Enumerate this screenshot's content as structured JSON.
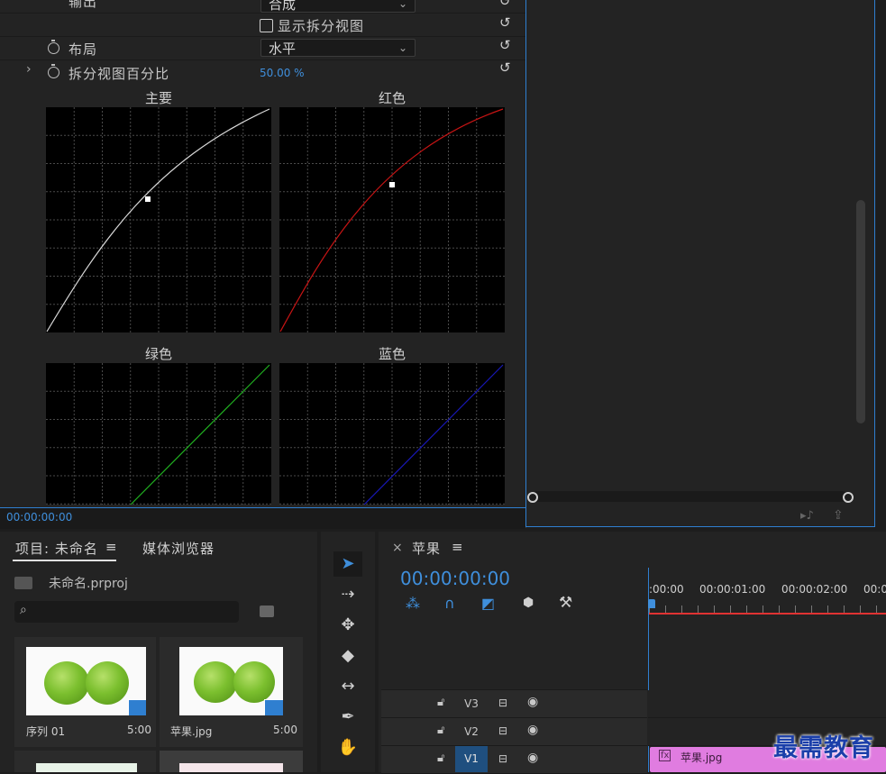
{
  "effect_controls": {
    "rows": {
      "output": {
        "label": "输出",
        "value": "合成"
      },
      "show_split": {
        "label": "显示拆分视图"
      },
      "layout": {
        "label": "布局",
        "value": "水平"
      },
      "split_percent": {
        "label": "拆分视图百分比",
        "value": "50.00 %"
      }
    },
    "graphs": {
      "master": {
        "title": "主要",
        "color": "#d9d9d9"
      },
      "red": {
        "title": "红色",
        "color": "#c81414"
      },
      "green": {
        "title": "绿色",
        "color": "#20b020"
      },
      "blue": {
        "title": "蓝色",
        "color": "#1818b8"
      }
    },
    "timecode": "00:00:00:00"
  },
  "project": {
    "tab_project": "项目: 未命名",
    "tab_media": "媒体浏览器",
    "file": "未命名.prproj",
    "items": [
      {
        "name": "序列 01",
        "duration": "5:00"
      },
      {
        "name": "苹果.jpg",
        "duration": "5:00"
      }
    ]
  },
  "timeline": {
    "sequence": "苹果",
    "timecode": "00:00:00:00",
    "ruler": [
      ":00:00",
      "00:00:01:00",
      "00:00:02:00",
      "00:0"
    ],
    "tracks": [
      {
        "name": "V3"
      },
      {
        "name": "V2"
      },
      {
        "name": "V1"
      }
    ],
    "clip": "苹果.jpg",
    "clip_color": "#e07ce0"
  },
  "watermark": "最需教育",
  "accent": "#2f7fd0"
}
